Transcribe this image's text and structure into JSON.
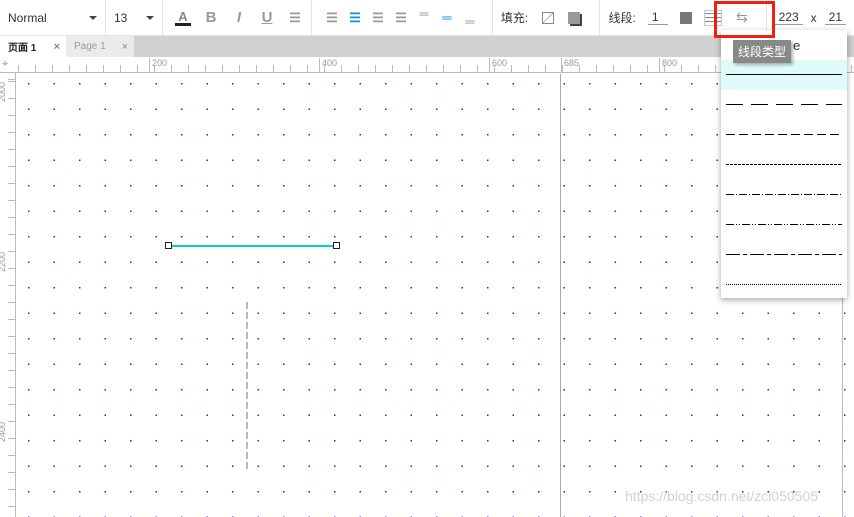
{
  "toolbar": {
    "font": "Normal",
    "size": "13",
    "fill_label": "填充:",
    "stroke_label": "线段:",
    "stroke_width": "1",
    "width": "223",
    "x_sep": "x",
    "height": "21"
  },
  "tabs": [
    {
      "label": "页面 1",
      "close": "×"
    },
    {
      "label": "Page 1",
      "close": "×"
    }
  ],
  "ruler": {
    "h": [
      "200",
      "400",
      "600",
      "685",
      "800"
    ],
    "v": [
      "2000",
      "2200",
      "2400"
    ]
  },
  "dropdown": {
    "tooltip": "线段类型",
    "partial_text": "e",
    "options": [
      "solid",
      "long-dash",
      "dash",
      "fine-dash",
      "dash-dot",
      "dash-dot-dot",
      "long-dash-dot",
      "dotted"
    ],
    "selected": "solid"
  },
  "colors": {
    "accent": "#0f8fde",
    "selected_line": "#00d0c8",
    "highlight_box": "#f02010"
  },
  "watermark": "https://blog.csdn.net/zcl050505"
}
